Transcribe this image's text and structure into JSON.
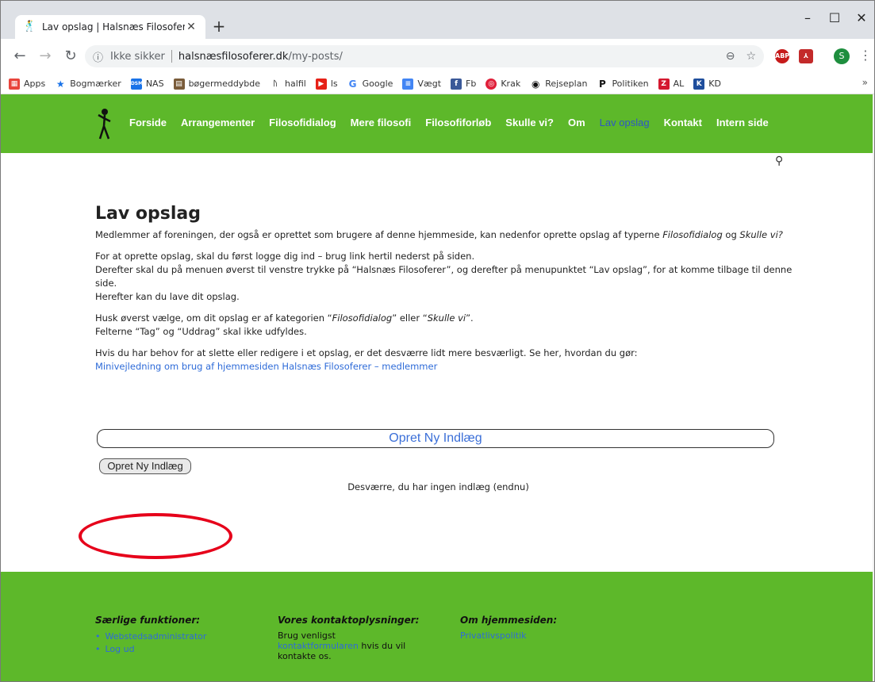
{
  "browser": {
    "tab_title": "Lav opslag | Halsnæs Filosoferer",
    "new_tab": "+",
    "url_security": "Ikke sikker",
    "url_host": "halsnæsfilosoferer.dk",
    "url_path": "/my-posts/",
    "avatar_letter": "S",
    "bookmarks": [
      {
        "label": "Apps",
        "icon": "apps-grid",
        "color": "#e8453c"
      },
      {
        "label": "Bogmærker",
        "icon": "star",
        "color": "#1a73e8"
      },
      {
        "label": "NAS",
        "icon": "dsm",
        "color": "#1a73e8"
      },
      {
        "label": "bøgermeddybde",
        "icon": "book",
        "color": "#7a5c3a"
      },
      {
        "label": "halfil",
        "icon": "philosopher",
        "color": "#333333"
      },
      {
        "label": "ls",
        "icon": "youtube",
        "color": "#e62117"
      },
      {
        "label": "Google",
        "icon": "google",
        "color": "#4285f4"
      },
      {
        "label": "Vægt",
        "icon": "doc",
        "color": "#4285f4"
      },
      {
        "label": "Fb",
        "icon": "facebook",
        "color": "#3b5998"
      },
      {
        "label": "Krak",
        "icon": "krak",
        "color": "#e0203a"
      },
      {
        "label": "Rejseplan",
        "icon": "target",
        "color": "#111111"
      },
      {
        "label": "Politiken",
        "icon": "politiken",
        "color": "#111111"
      },
      {
        "label": "AL",
        "icon": "al",
        "color": "#d4182f"
      },
      {
        "label": "KD",
        "icon": "kd",
        "color": "#1f4e9c"
      }
    ],
    "more": "»"
  },
  "nav": {
    "items": [
      "Forside",
      "Arrangementer",
      "Filosofidialog",
      "Mere filosofi",
      "Filosofiforløb",
      "Skulle vi?",
      "Om",
      "Lav opslag",
      "Kontakt",
      "Intern side"
    ],
    "active_index": 7
  },
  "content": {
    "title": "Lav opslag",
    "p1_a": "Medlemmer af foreningen, der også er oprettet som brugere af denne hjemmeside, kan nedenfor oprette opslag af typerne ",
    "p1_em1": "Filosofidialog",
    "p1_b": " og ",
    "p1_em2": "Skulle vi?",
    "p2_l1": "For at oprette opslag, skal du først logge dig ind – brug link hertil nederst på siden.",
    "p2_l2": "Derefter skal du på menuen øverst til venstre trykke på “Halsnæs Filosoferer”, og derefter på menupunktet “Lav opslag”, for at komme tilbage til denne side.",
    "p2_l3": "Herefter kan du lave dit opslag.",
    "p3_a": "Husk øverst vælge, om dit opslag er af kategorien “",
    "p3_em1": "Filosofidialog",
    "p3_b": "” eller “",
    "p3_em2": "Skulle vi",
    "p3_c": "”.",
    "p3_l2": "Felterne “Tag” og “Uddrag” skal ikke udfyldes.",
    "p4": "Hvis du har behov for at slette eller redigere i et opslag, er det desværre lidt mere besværligt. Se her, hvordan du gør:",
    "p4_link": "Minivejledning om brug af hjemmesiden Halsnæs Filosoferer – medlemmer",
    "big_button": "Opret Ny Indlæg",
    "small_button": "Opret Ny Indlæg",
    "no_posts": "Desværre, du har ingen indlæg (endnu)"
  },
  "footer": {
    "col1_title": "Særlige funktioner:",
    "col1_items": [
      "Webstedsadministrator",
      "Log ud"
    ],
    "col2_title": "Vores kontaktoplysninger:",
    "col2_t1": "Brug venligst",
    "col2_link": "kontaktformularen",
    "col2_t2": " hvis du vil",
    "col2_t3": "kontakte os.",
    "col3_title": "Om hjemmesiden:",
    "col3_link": "Privatlivspolitik"
  },
  "colors": {
    "green": "#5db82a",
    "link": "#2e6bd8",
    "highlight_oval": "#e6001a"
  }
}
